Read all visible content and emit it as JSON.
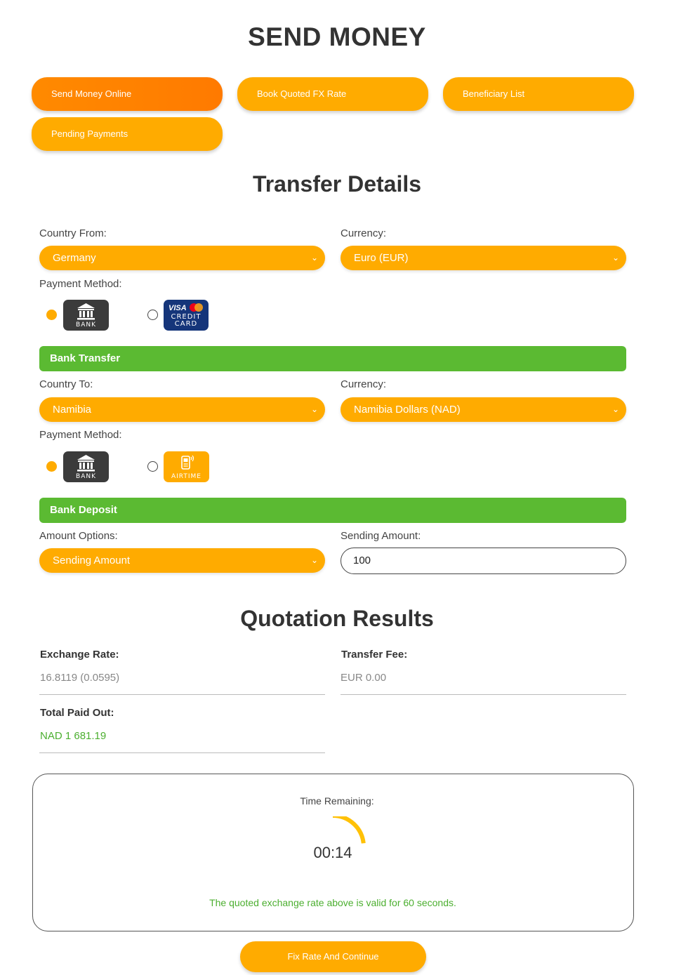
{
  "header": {
    "title": "SEND MONEY"
  },
  "nav": {
    "send_money_online": "Send Money Online",
    "book_quoted_fx_rate": "Book Quoted FX Rate",
    "beneficiary_list": "Beneficiary List",
    "pending_payments": "Pending Payments"
  },
  "transfer": {
    "title": "Transfer Details",
    "country_from_label": "Country From:",
    "country_from_value": "Germany",
    "currency_from_label": "Currency:",
    "currency_from_value": "Euro (EUR)",
    "payment_method_from_label": "Payment Method:",
    "bank_caption": "BANK",
    "visa_text": "VISA",
    "credit_card_caption": "CREDIT CARD",
    "bank_transfer_bar": "Bank Transfer",
    "country_to_label": "Country To:",
    "country_to_value": "Namibia",
    "currency_to_label": "Currency:",
    "currency_to_value": "Namibia Dollars (NAD)",
    "payment_method_to_label": "Payment Method:",
    "bank_caption_2": "BANK",
    "airtime_caption": "AIRTIME",
    "bank_deposit_bar": "Bank Deposit",
    "amount_options_label": "Amount Options:",
    "amount_options_value": "Sending Amount",
    "sending_amount_label": "Sending Amount:",
    "sending_amount_value": "100"
  },
  "quotation": {
    "title": "Quotation Results",
    "exchange_rate_label": "Exchange Rate:",
    "exchange_rate_value": "16.8119 (0.0595)",
    "transfer_fee_label": "Transfer Fee:",
    "transfer_fee_value": "EUR 0.00",
    "total_paid_out_label": "Total Paid Out:",
    "total_paid_out_value": "NAD 1 681.19"
  },
  "timer": {
    "label": "Time Remaining:",
    "value": "00:14",
    "remaining_fraction": 0.233,
    "note": "The quoted exchange rate above is valid for 60 seconds."
  },
  "actions": {
    "fix_rate": "Fix Rate And Continue"
  },
  "colors": {
    "accent": "#ffab00",
    "active_tab": "#ff8000",
    "success_bar": "#5bba32",
    "visa_blue": "#15357a"
  }
}
